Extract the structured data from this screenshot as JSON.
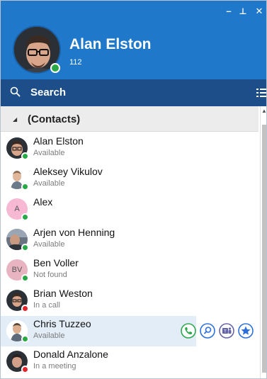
{
  "window": {
    "minimize_glyph": "–",
    "pin_glyph": "⊥",
    "close_glyph": "✕"
  },
  "profile": {
    "name": "Alan Elston",
    "extension": "112",
    "status_color": "#27a844"
  },
  "search": {
    "label": "Search",
    "icon": "search-icon"
  },
  "group": {
    "label": "(Contacts)",
    "caret": "◢"
  },
  "contacts": [
    {
      "name": "Alan Elston",
      "status": "Available",
      "status_color": "#27a844",
      "avatar": "photo"
    },
    {
      "name": "Aleksey Vikulov",
      "status": "Available",
      "status_color": "#27a844",
      "avatar": "photo"
    },
    {
      "name": "Alex",
      "status": "",
      "status_color": "#27a844",
      "avatar": "initials",
      "initials": "A",
      "avatar_bg": "#f6b8d3"
    },
    {
      "name": "Arjen von Henning",
      "status": "Available",
      "status_color": "#27a844",
      "avatar": "photo"
    },
    {
      "name": "Ben Voller",
      "status": "Not found",
      "status_color": "#27a844",
      "avatar": "initials",
      "initials": "BV",
      "avatar_bg": "#e8b4c2"
    },
    {
      "name": "Brian Weston",
      "status": "In a call",
      "status_color": "#e3242b",
      "avatar": "photo"
    },
    {
      "name": "Chris Tuzzeo",
      "status": "Available",
      "status_color": "#27a844",
      "avatar": "photo"
    },
    {
      "name": "Donald Anzalone",
      "status": "In a meeting",
      "status_color": "#e3242b",
      "avatar": "photo"
    }
  ],
  "row_actions": {
    "call_icon": "phone-icon",
    "lookup_icon": "magnify-icon",
    "teams_icon": "teams-icon",
    "favorite_icon": "star-icon"
  },
  "colors": {
    "header_bg": "#1f78c9",
    "search_bg": "#1d4e89",
    "available": "#27a844",
    "busy": "#e3242b"
  }
}
